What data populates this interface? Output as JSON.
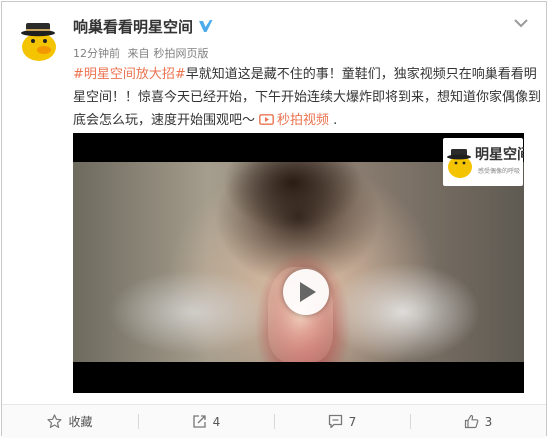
{
  "post": {
    "author": "响巢看看明星空间",
    "verified_icon": "verified-v-icon",
    "time": "12分钟前",
    "source_prefix": "来自",
    "source": "秒拍网页版",
    "hashtag": "#明星空间放大招#",
    "text": "早就知道这是藏不住的事！童鞋们，独家视频只在响巢看看明星空间！！惊喜今天已经开始，下午开始连续大爆炸即将到来，想知道你家偶像到底会怎么玩，速度开始围观吧～",
    "video_link": "秒拍视频",
    "text_end": " ."
  },
  "video": {
    "play_icon": "play-icon",
    "watermark_title": "明星空间",
    "watermark_subtitle": "感受偶像的呼吸"
  },
  "actions": {
    "favorite": {
      "icon": "star-icon",
      "label": "收藏"
    },
    "repost": {
      "icon": "repost-icon",
      "label": "4"
    },
    "comment": {
      "icon": "comment-icon",
      "label": "7"
    },
    "like": {
      "icon": "thumbs-up-icon",
      "label": "3"
    }
  },
  "colors": {
    "link": "#eb7350",
    "verified": "#4dabec",
    "mascot_yellow": "#f5c400"
  }
}
